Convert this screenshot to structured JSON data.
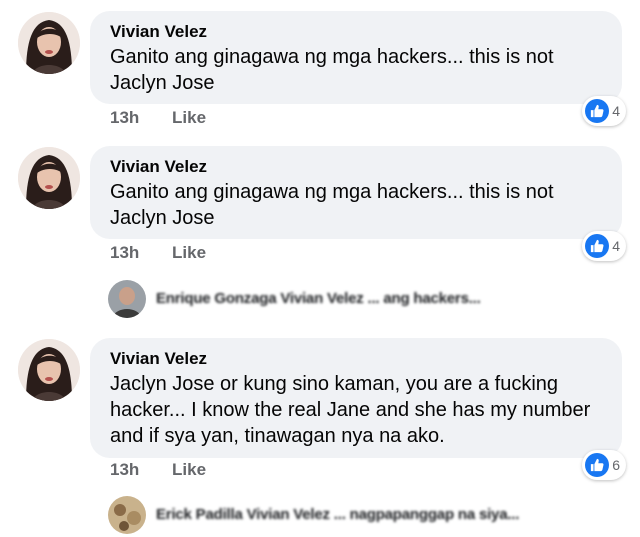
{
  "comments": [
    {
      "author": "Vivian Velez",
      "text_lines": [
        "Ganito ang ginagawa ng mga hackers... this is not",
        "Jaclyn Jose"
      ],
      "time": "13h",
      "like_label": "Like",
      "reaction_count": "4"
    },
    {
      "author": "Vivian Velez",
      "text_lines": [
        "Ganito ang ginagawa ng mga hackers... this is not",
        "Jaclyn Jose"
      ],
      "time": "13h",
      "like_label": "Like",
      "reaction_count": "4"
    },
    {
      "author": "Vivian Velez",
      "text_lines": [
        "Jaclyn Jose or kung sino kaman, you are a fucking",
        "hacker... I know the real Jane and she has my number",
        "and if sya yan, tinawagan nya na ako."
      ],
      "time": "13h",
      "like_label": "Like",
      "reaction_count": "6"
    }
  ],
  "replies": [
    {
      "preview": "Enrique Gonzaga Vivian Velez ... ang hackers..."
    },
    {
      "preview": "Erick Padilla Vivian Velez ... nagpapanggap na siya..."
    }
  ],
  "colors": {
    "bubble": "#f0f2f5",
    "meta": "#65676b",
    "like_blue": "#1877f2"
  },
  "icons": {
    "like": "thumbs-up-icon"
  }
}
